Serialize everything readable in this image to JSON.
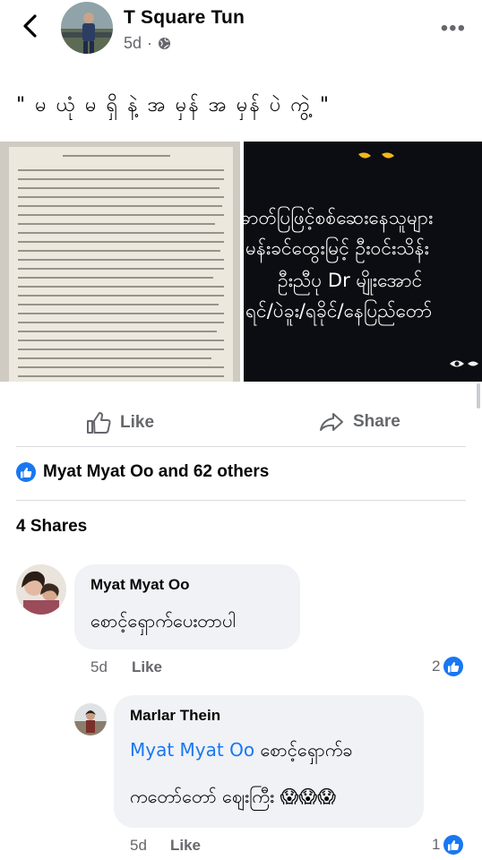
{
  "post": {
    "author": "T Square Tun",
    "time": "5d",
    "separator": "·",
    "text": "\" မ ယုံ မ ရှိ နဲ့ အ မှန် အ မှန် ပဲ ကွဲ့ \"",
    "image_right_lines": [
      "ဓာတ်ပြဖြင့်စစ်ဆေးနေသူများ",
      "မန်းခင်ထွေးမြင့် ဦးဝင်းသိန်း",
      "ဦးညီပု Dr မျိုးအောင်",
      "ရင်/ပဲခူး/ရခိုင်/နေပြည်တော်"
    ]
  },
  "actions": {
    "like": "Like",
    "share": "Share"
  },
  "reactions_text": "Myat Myat Oo and 62 others",
  "shares_text": "4 Shares",
  "comments": [
    {
      "name": "Myat Myat Oo",
      "text": "စောင့်ရှောက်ပေးတာပါ",
      "time": "5d",
      "like": "Like",
      "likes": "2"
    },
    {
      "name": "Marlar Thein",
      "mention": "Myat Myat Oo",
      "text1": "စောင့်ရှောက်ခ",
      "text2": "ကတော်တော် ဈေးကြီး",
      "emoji": "😱😱😱",
      "time": "5d",
      "like": "Like",
      "likes": "1"
    }
  ],
  "colors": {
    "accent": "#1877f2",
    "secondary_text": "#65676b",
    "bubble": "#f0f2f5"
  },
  "icons": [
    "back-arrow-icon",
    "globe-icon",
    "more-icon",
    "like-icon",
    "share-icon",
    "like-reaction-icon"
  ]
}
